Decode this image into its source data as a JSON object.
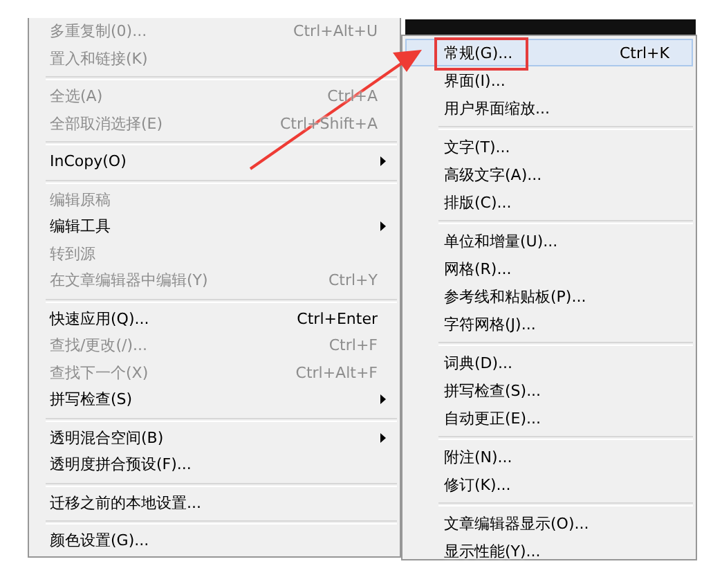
{
  "edit_menu": [
    {
      "kind": "item",
      "label": "多重复制(0)...",
      "shortcut": "Ctrl+Alt+U",
      "disabled": true,
      "submenu": false
    },
    {
      "kind": "item",
      "label": "置入和链接(K)",
      "disabled": true,
      "submenu": false
    },
    {
      "kind": "separator"
    },
    {
      "kind": "item",
      "label": "全选(A)",
      "shortcut": "Ctrl+A",
      "disabled": true,
      "submenu": false
    },
    {
      "kind": "item",
      "label": "全部取消选择(E)",
      "shortcut": "Ctrl+Shift+A",
      "disabled": true,
      "submenu": false
    },
    {
      "kind": "separator"
    },
    {
      "kind": "item",
      "label": "InCopy(O)",
      "disabled": false,
      "submenu": true
    },
    {
      "kind": "separator"
    },
    {
      "kind": "item",
      "label": "编辑原稿",
      "disabled": true,
      "submenu": false
    },
    {
      "kind": "item",
      "label": "编辑工具",
      "disabled": false,
      "submenu": true
    },
    {
      "kind": "item",
      "label": "转到源",
      "disabled": true,
      "submenu": false
    },
    {
      "kind": "item",
      "label": "在文章编辑器中编辑(Y)",
      "shortcut": "Ctrl+Y",
      "disabled": true,
      "submenu": false
    },
    {
      "kind": "separator"
    },
    {
      "kind": "item",
      "label": "快速应用(Q)...",
      "shortcut": "Ctrl+Enter",
      "disabled": false,
      "submenu": false
    },
    {
      "kind": "item",
      "label": "查找/更改(/)...",
      "shortcut": "Ctrl+F",
      "disabled": true,
      "submenu": false
    },
    {
      "kind": "item",
      "label": "查找下一个(X)",
      "shortcut": "Ctrl+Alt+F",
      "disabled": true,
      "submenu": false
    },
    {
      "kind": "item",
      "label": "拼写检查(S)",
      "disabled": false,
      "submenu": true
    },
    {
      "kind": "separator"
    },
    {
      "kind": "item",
      "label": "透明混合空间(B)",
      "disabled": false,
      "submenu": true
    },
    {
      "kind": "item",
      "label": "透明度拼合预设(F)...",
      "disabled": false,
      "submenu": false
    },
    {
      "kind": "separator"
    },
    {
      "kind": "item",
      "label": "迁移之前的本地设置...",
      "disabled": false,
      "submenu": false
    },
    {
      "kind": "separator"
    },
    {
      "kind": "item",
      "label": "颜色设置(G)...",
      "disabled": false,
      "submenu": false
    }
  ],
  "preferences_submenu": [
    {
      "kind": "item",
      "label": "常规(G)...",
      "shortcut": "Ctrl+K",
      "selected": true,
      "outlined": true
    },
    {
      "kind": "item",
      "label": "界面(I)...",
      "selected": false,
      "outlined": false
    },
    {
      "kind": "item",
      "label": "用户界面缩放...",
      "selected": false,
      "outlined": false
    },
    {
      "kind": "separator"
    },
    {
      "kind": "item",
      "label": "文字(T)...",
      "selected": false,
      "outlined": false
    },
    {
      "kind": "item",
      "label": "高级文字(A)...",
      "selected": false,
      "outlined": false
    },
    {
      "kind": "item",
      "label": "排版(C)...",
      "selected": false,
      "outlined": false
    },
    {
      "kind": "separator"
    },
    {
      "kind": "item",
      "label": "单位和增量(U)...",
      "selected": false,
      "outlined": false
    },
    {
      "kind": "item",
      "label": "网格(R)...",
      "selected": false,
      "outlined": false
    },
    {
      "kind": "item",
      "label": "参考线和粘贴板(P)...",
      "selected": false,
      "outlined": false
    },
    {
      "kind": "item",
      "label": "字符网格(J)...",
      "selected": false,
      "outlined": false
    },
    {
      "kind": "separator"
    },
    {
      "kind": "item",
      "label": "词典(D)...",
      "selected": false,
      "outlined": false
    },
    {
      "kind": "item",
      "label": "拼写检查(S)...",
      "selected": false,
      "outlined": false
    },
    {
      "kind": "item",
      "label": "自动更正(E)...",
      "selected": false,
      "outlined": false
    },
    {
      "kind": "separator"
    },
    {
      "kind": "item",
      "label": "附注(N)...",
      "selected": false,
      "outlined": false
    },
    {
      "kind": "item",
      "label": "修订(K)...",
      "selected": false,
      "outlined": false
    },
    {
      "kind": "separator"
    },
    {
      "kind": "item",
      "label": "文章编辑器显示(O)...",
      "selected": false,
      "outlined": false
    },
    {
      "kind": "item",
      "label": "显示性能(Y)...",
      "selected": false,
      "outlined": false
    }
  ]
}
